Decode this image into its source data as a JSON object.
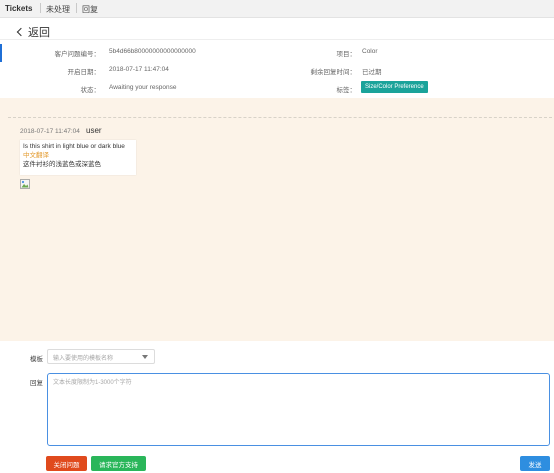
{
  "topnav": {
    "items": [
      "Tickets",
      "未处理",
      "回复"
    ]
  },
  "back": {
    "label": "返回"
  },
  "ticket": {
    "id_label": "客户问题编号：",
    "id_value": "5b4d66b80000000000000000",
    "project_label": "项目：",
    "project_value": "Color",
    "open_date_label": "开启日期：",
    "open_date_value": "2018-07-17 11:47:04",
    "remaining_label": "剩余回复时间：",
    "remaining_value": "已过期",
    "status_label": "状态：",
    "status_value": "Awaiting your response",
    "tag_label": "标签：",
    "tag_value": "Size/Color Preference"
  },
  "message": {
    "time": "2018-07-17 11:47:04",
    "user": "user",
    "text": "Is this shirt in light blue or dark blue",
    "translate_link": "中文翻译",
    "translated_text": "这件衬衫的浅蓝色或深蓝色"
  },
  "reply_form": {
    "template_label": "模板",
    "template_placeholder": "输入要使用的模板名称",
    "reply_label": "回复",
    "reply_placeholder": "文本长度限制为1-3000个字符",
    "close_button": "关闭问题",
    "official_button": "请求官方支持",
    "send_button": "发送"
  },
  "colors": {
    "tag": "#1aa39a",
    "chat_background": "#fcf3e8",
    "close_button": "#e04a1d",
    "official_button": "#2ab65a",
    "send_button": "#2e8ee0",
    "translate_link": "#e39a2d"
  }
}
